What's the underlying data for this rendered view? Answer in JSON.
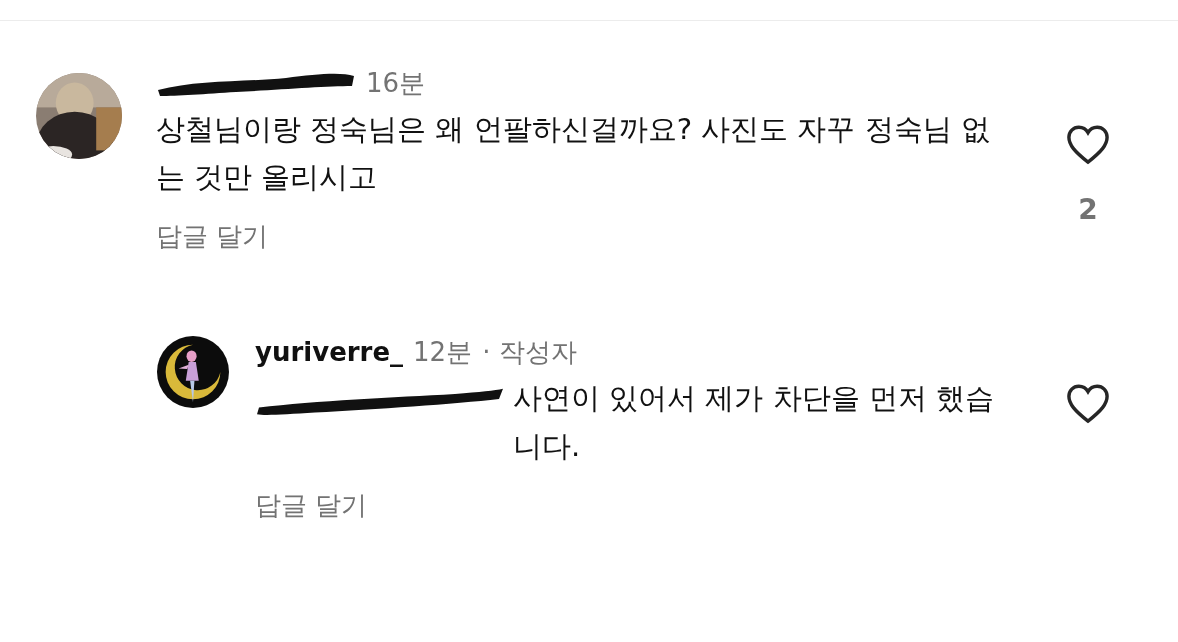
{
  "comments": [
    {
      "username_redacted": true,
      "time": "16분",
      "text": "상철님이랑 정숙님은 왜 언팔하신걸까요? 사진도 자꾸 정숙님 없는 것만 올리시고",
      "reply_link": "답글 달기",
      "like_count": "2",
      "replies": [
        {
          "username": "yuriverre_",
          "time": "12분",
          "author_tag": "· 작성자",
          "mention_redacted": true,
          "text": "사연이 있어서 제가 차단을 먼저 했습니다.",
          "reply_link": "답글 달기"
        }
      ]
    }
  ]
}
